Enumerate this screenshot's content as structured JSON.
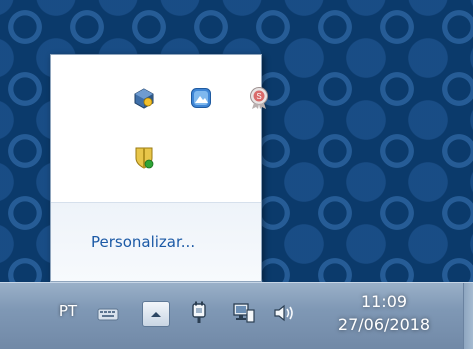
{
  "popup": {
    "icons": [
      {
        "name": "virtualbox-icon"
      },
      {
        "name": "photos-app-icon"
      },
      {
        "name": "ssl-badge-icon"
      },
      {
        "name": "security-shield-icon"
      }
    ],
    "customize_label": "Personalizar..."
  },
  "taskbar": {
    "language": "PT",
    "time": "11:09",
    "date": "27/06/2018"
  },
  "colors": {
    "desktop_bg": "#0b3a6b",
    "taskbar": "#7f98b5",
    "link": "#1c5aa6"
  }
}
